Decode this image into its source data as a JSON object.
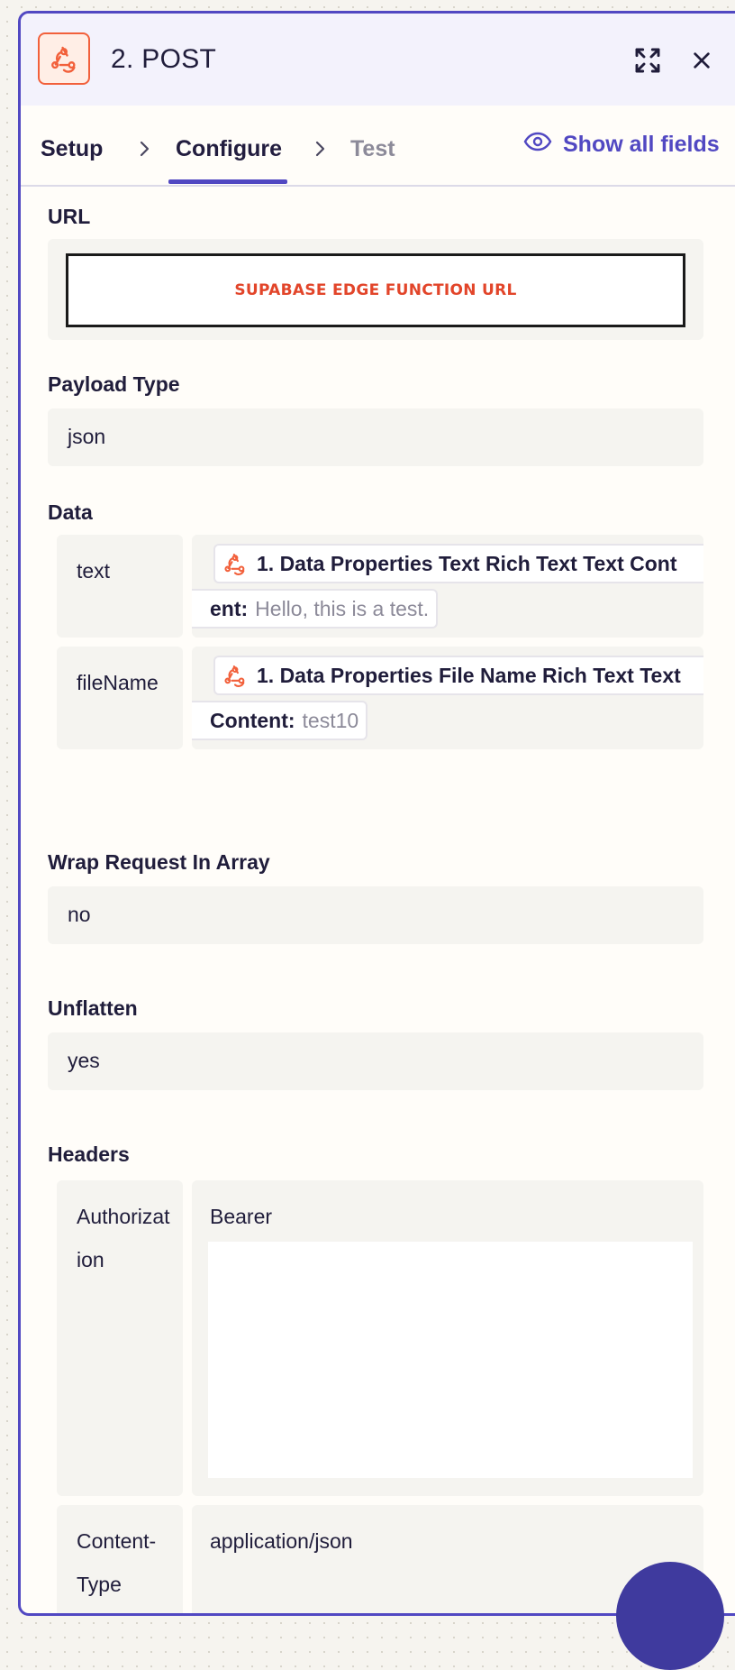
{
  "header": {
    "step_title": "2. POST",
    "app_icon": "webhook-icon",
    "expand_icon": "expand-icon",
    "close_icon": "close-icon"
  },
  "tabs": {
    "items": [
      {
        "label": "Setup",
        "state": "done"
      },
      {
        "label": "Configure",
        "state": "active"
      },
      {
        "label": "Test",
        "state": "disabled"
      }
    ],
    "show_all_fields": "Show all fields"
  },
  "fields": {
    "url": {
      "label": "URL",
      "value": "SUPABASE EDGE FUNCTION URL"
    },
    "payload_type": {
      "label": "Payload Type",
      "value": "json"
    },
    "data": {
      "label": "Data",
      "rows": [
        {
          "key": "text",
          "pill_label": "1. Data Properties Text Rich Text Text Cont",
          "pill_label_cont": "ent:",
          "pill_value": "Hello, this is a test."
        },
        {
          "key": "fileName",
          "pill_label": "1. Data Properties File Name Rich Text Text",
          "pill_label_cont": "Content:",
          "pill_value": "test10"
        }
      ]
    },
    "wrap_request": {
      "label": "Wrap Request In Array",
      "value": "no"
    },
    "unflatten": {
      "label": "Unflatten",
      "value": "yes"
    },
    "headers": {
      "label": "Headers",
      "rows": [
        {
          "key_line1": "Authorizat",
          "key_line2": "ion",
          "value": "Bearer"
        },
        {
          "key_line1": "Content-",
          "key_line2": "Type",
          "value": "application/json"
        }
      ]
    }
  },
  "colors": {
    "accent": "#5148c2",
    "brand_orange": "#f2603b"
  }
}
